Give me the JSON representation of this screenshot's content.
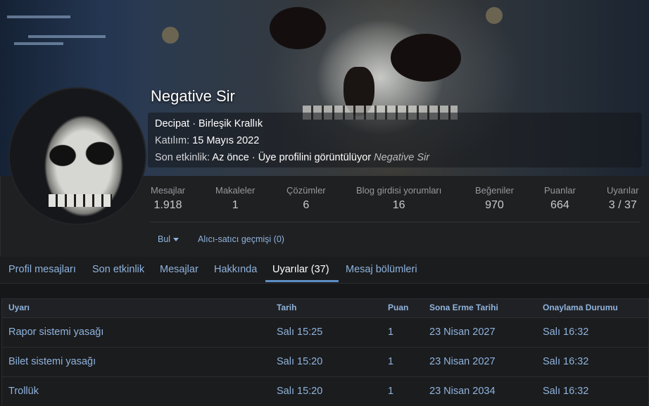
{
  "profile": {
    "username": "Negative Sir",
    "location_line": "Decipat · Birleşik Krallık",
    "joined_label": "Katılım:",
    "joined_value": "15 Mayıs 2022",
    "activity_label": "Son etkinlik:",
    "activity_value": "Az önce · Üye profilini görüntülüyor",
    "activity_target": "Negative Sir"
  },
  "stats": [
    {
      "label": "Mesajlar",
      "value": "1.918"
    },
    {
      "label": "Makaleler",
      "value": "1"
    },
    {
      "label": "Çözümler",
      "value": "6"
    },
    {
      "label": "Blog girdisi yorumları",
      "value": "16"
    },
    {
      "label": "Beğeniler",
      "value": "970"
    },
    {
      "label": "Puanlar",
      "value": "664"
    },
    {
      "label": "Uyarılar",
      "value": "3 / 37"
    }
  ],
  "actions": {
    "find_label": "Bul",
    "trade_history": "Alıcı-satıcı geçmişi (0)"
  },
  "tabs": [
    {
      "label": "Profil mesajları"
    },
    {
      "label": "Son etkinlik"
    },
    {
      "label": "Mesajlar"
    },
    {
      "label": "Hakkında"
    },
    {
      "label": "Uyarılar (37)"
    },
    {
      "label": "Mesaj bölümleri"
    }
  ],
  "table": {
    "headers": [
      "Uyarı",
      "Tarih",
      "Puan",
      "Sona Erme Tarihi",
      "Onaylama Durumu"
    ],
    "rows": [
      [
        "Rapor sistemi yasağı",
        "Salı 15:25",
        "1",
        "23 Nisan 2027",
        "Salı 16:32"
      ],
      [
        "Bilet sistemi yasağı",
        "Salı 15:20",
        "1",
        "23 Nisan 2027",
        "Salı 16:32"
      ],
      [
        "Trollük",
        "Salı 15:20",
        "1",
        "23 Nisan 2034",
        "Salı 16:32"
      ]
    ]
  },
  "colors": {
    "link": "#8fb3dd",
    "accent": "#5d8ec4",
    "background": "#161719"
  }
}
